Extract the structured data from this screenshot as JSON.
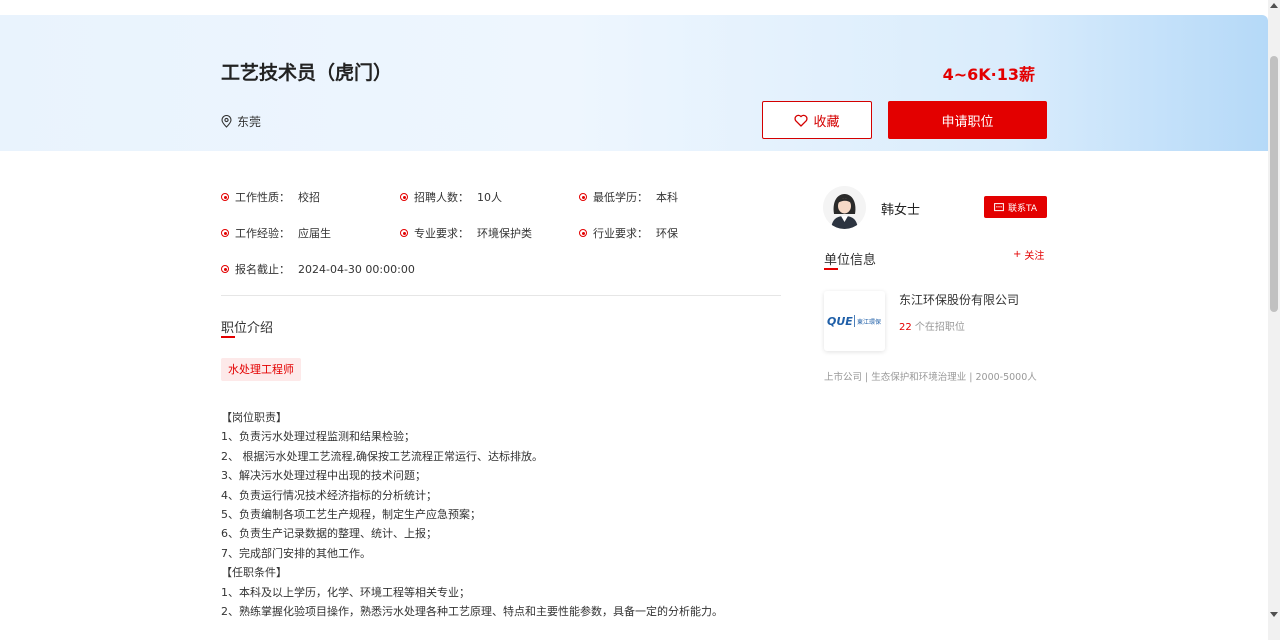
{
  "job": {
    "title": "工艺技术员（虎门）",
    "salary": "4~6K·13薪",
    "location": "东莞",
    "fav_label": "收藏",
    "apply_label": "申请职位"
  },
  "attributes": [
    {
      "key": "工作性质：",
      "value": "校招"
    },
    {
      "key": "招聘人数：",
      "value": "10人"
    },
    {
      "key": "最低学历：",
      "value": "本科"
    },
    {
      "key": "工作经验：",
      "value": "应届生"
    },
    {
      "key": "专业要求：",
      "value": "环境保护类"
    },
    {
      "key": "行业要求：",
      "value": "环保"
    },
    {
      "key": "报名截止：",
      "value": "2024-04-30 00:00:00"
    }
  ],
  "intro": {
    "title": "职位介绍",
    "tag": "水处理工程师",
    "lines": [
      "【岗位职责】",
      "1、负责污水处理过程监测和结果检验；",
      "2、 根据污水处理工艺流程,确保按工艺流程正常运行、达标排放。",
      "3、解决污水处理过程中出现的技术问题；",
      "4、负责运行情况技术经济指标的分析统计；",
      "5、负责编制各项工艺生产规程，制定生产应急预案；",
      "6、负责生产记录数据的整理、统计、上报；",
      "7、完成部门安排的其他工作。",
      "【任职条件】",
      "1、本科及以上学历，化学、环境工程等相关专业；",
      "2、熟练掌握化验项目操作，熟悉污水处理各种工艺原理、特点和主要性能参数，具备一定的分析能力。"
    ]
  },
  "recruiter": {
    "name": "韩女士",
    "contact_label": "联系TA"
  },
  "company": {
    "section_title": "单位信息",
    "follow_label": "关注",
    "name": "东江环保股份有限公司",
    "jobs_count": "22",
    "jobs_suffix": " 个在招职位",
    "meta": "上市公司 | 生态保护和环境治理业 | 2000-5000人",
    "logo_text": "東江環保",
    "logo_mark": "QUE"
  },
  "colors": {
    "accent": "#e30000",
    "hero_start": "#e9f3fd",
    "hero_end": "#b5d9f8"
  }
}
